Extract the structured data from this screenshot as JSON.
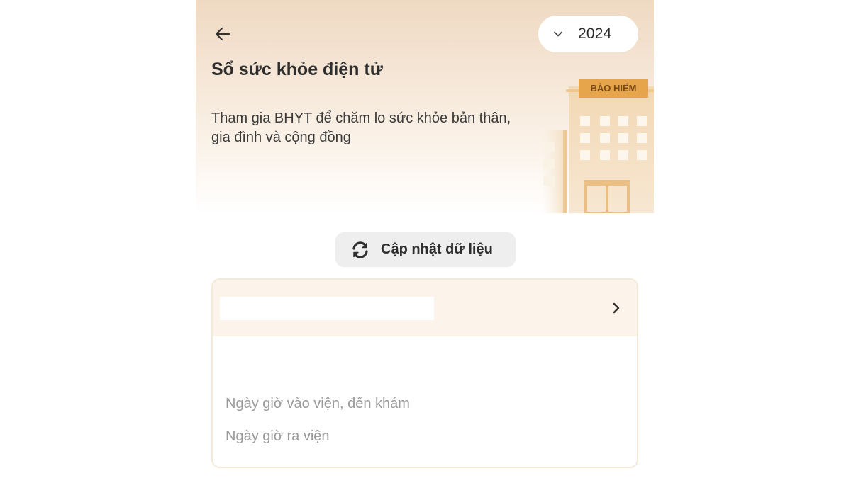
{
  "header": {
    "back_icon": "arrow-left-icon",
    "year_select": {
      "value": "2024",
      "icon": "chevron-down-icon"
    },
    "title": "Sổ sức khỏe điện tử",
    "subtitle": "Tham gia BHYT để chăm lo sức khỏe bản thân, gia đình và cộng đồng",
    "building_sign": "BẢO HIỂM"
  },
  "refresh": {
    "icon": "refresh-icon",
    "label": "Cập nhật dữ liệu"
  },
  "record_card": {
    "name": "",
    "chevron_icon": "chevron-right-icon",
    "admission_label": "Ngày giờ vào viện, đến khám",
    "discharge_label": "Ngày giờ ra viện"
  },
  "colors": {
    "hero_top": "#efd9c2",
    "accent": "#e8a84a",
    "card_border": "#f3ead8",
    "card_header": "#fcf3ea",
    "muted_text": "#9a9a9a"
  }
}
